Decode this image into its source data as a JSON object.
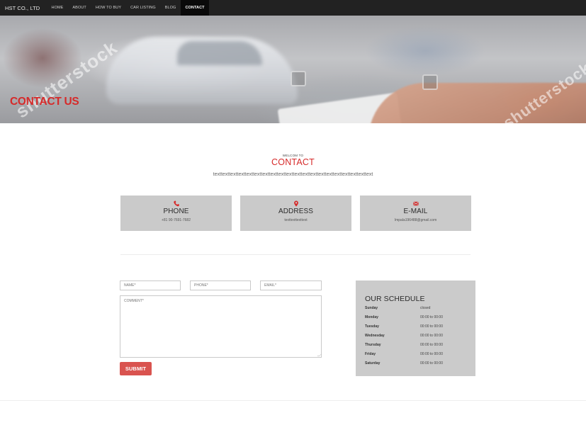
{
  "nav": {
    "brand": "HST CO., LTD",
    "links": [
      {
        "label": "HOME"
      },
      {
        "label": "ABOUT"
      },
      {
        "label": "HOW TO BUY"
      },
      {
        "label": "CAR LISTING"
      },
      {
        "label": "BLOG"
      },
      {
        "label": "CONTACT",
        "active": true
      }
    ]
  },
  "hero": {
    "title": "CONTACT US",
    "watermark": "shutterstock"
  },
  "section": {
    "kicker": "WELCOM TO",
    "title": "CONTACT",
    "lead": "texttexttexttexttexttexttexttexttexttexttexttexttexttexttexttexttexttexttexttext"
  },
  "cards": [
    {
      "icon": "phone-icon",
      "title": "PHONE",
      "value": "+81 90-7691-7682"
    },
    {
      "icon": "map-pin-icon",
      "title": "ADDRESS",
      "value": "texttexttexttext"
    },
    {
      "icon": "envelope-icon",
      "title": "E-MAIL",
      "value": "Impala196488@gmail.com"
    }
  ],
  "form": {
    "name_placeholder": "NAME*",
    "phone_placeholder": "PHONE*",
    "email_placeholder": "EMAIL*",
    "comment_placeholder": "COMMENT*",
    "submit_label": "SUBMIT"
  },
  "schedule": {
    "title": "OUR SCHEDULE",
    "rows": [
      {
        "day": "Sunday",
        "time": "closed"
      },
      {
        "day": "Monday",
        "time": "00:00 to 00:00"
      },
      {
        "day": "Tuesday",
        "time": "00:00 to 00:00"
      },
      {
        "day": "Wednesday",
        "time": "00:00 to 00:00"
      },
      {
        "day": "Thursday",
        "time": "00:00 to 00:00"
      },
      {
        "day": "Friday",
        "time": "00:00 to 00:00"
      },
      {
        "day": "Saturday",
        "time": "00:00 to 00:00"
      }
    ]
  },
  "colors": {
    "accent": "#d62a2a",
    "nav_bg": "#222222",
    "card_bg": "#cacaca",
    "submit_bg": "#d9534f"
  }
}
